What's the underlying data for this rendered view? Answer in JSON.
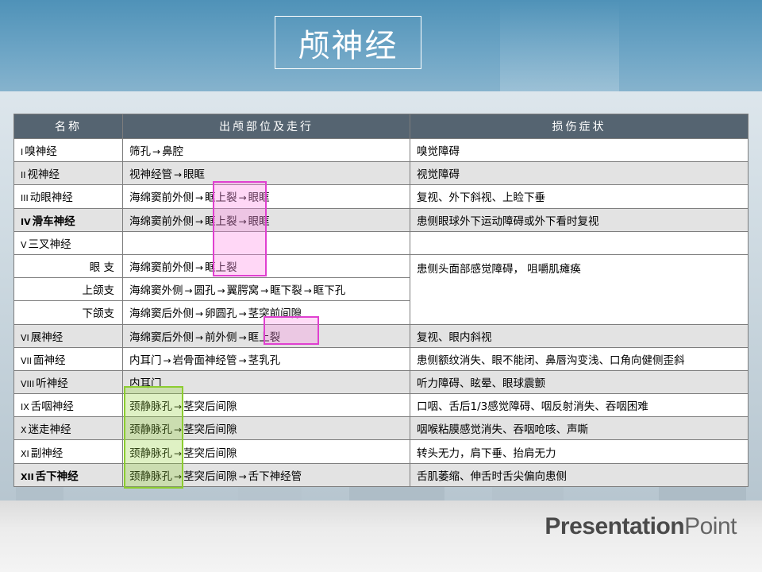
{
  "slide": {
    "title": "颅神经",
    "logo_bold": "Presentation",
    "logo_light": "Point"
  },
  "table": {
    "headers": [
      "名称",
      "出颅部位及走行",
      "损伤症状"
    ],
    "rows": [
      {
        "num": "I",
        "name": "嗅神经",
        "path": [
          "筛孔",
          "鼻腔"
        ],
        "symptom": "嗅觉障碍"
      },
      {
        "num": "II",
        "name": "视神经",
        "path": [
          "视神经管",
          "眼眶"
        ],
        "symptom": "视觉障碍"
      },
      {
        "num": "III",
        "name": "动眼神经",
        "path": [
          "海绵窦前外侧",
          "眶上裂",
          "眼眶"
        ],
        "symptom": "复视、外下斜视、上睑下垂"
      },
      {
        "num": "IV",
        "name": "滑车神经",
        "path": [
          "海绵窦前外侧",
          "眶上裂",
          "眼眶"
        ],
        "symptom": "患侧眼球外下运动障碍或外下看时复视"
      },
      {
        "num": "V",
        "name": "三叉神经"
      },
      {
        "name": "眼  支",
        "path": [
          "海绵窦前外侧",
          "眶上裂"
        ],
        "symptom": "患侧头面部感觉障碍， 咀嚼肌瘫痪"
      },
      {
        "name": "上颌支",
        "path": [
          "海绵窦外侧",
          "圆孔",
          "翼腭窝",
          "眶下裂",
          "眶下孔"
        ]
      },
      {
        "name": "下颌支",
        "path": [
          "海绵窦后外侧",
          "卵圆孔",
          "茎突前间隙"
        ]
      },
      {
        "num": "VI",
        "name": "展神经",
        "path": [
          "海绵窦后外侧",
          "前外侧",
          "眶上裂"
        ],
        "symptom": "复视、眼内斜视"
      },
      {
        "num": "VII",
        "name": "面神经",
        "path": [
          "内耳门",
          "岩骨面神经管",
          "茎乳孔"
        ],
        "symptom": "患侧额纹消失、眼不能闭、鼻唇沟变浅、口角向健侧歪斜"
      },
      {
        "num": "VIII",
        "name": "听神经",
        "path": [
          "内耳门"
        ],
        "symptom": "听力障碍、眩晕、眼球震颤"
      },
      {
        "num": "IX",
        "name": "舌咽神经",
        "path": [
          "颈静脉孔",
          "茎突后间隙"
        ],
        "symptom": "口咽、舌后1/3感觉障碍、咽反射消失、吞咽困难"
      },
      {
        "num": "X",
        "name": "迷走神经",
        "path": [
          "颈静脉孔",
          "茎突后间隙"
        ],
        "symptom": "咽喉粘膜感觉消失、吞咽呛咳、声嘶"
      },
      {
        "num": "XI",
        "name": "副神经",
        "path": [
          "颈静脉孔",
          "茎突后间隙"
        ],
        "symptom": "转头无力，肩下垂、抬肩无力"
      },
      {
        "num": "XII",
        "name": "舌下神经",
        "path": [
          "颈静脉孔",
          "茎突后间隙",
          "舌下神经管"
        ],
        "symptom": "舌肌萎缩、伸舌时舌尖偏向患侧"
      }
    ]
  },
  "arrow_glyph": "→"
}
